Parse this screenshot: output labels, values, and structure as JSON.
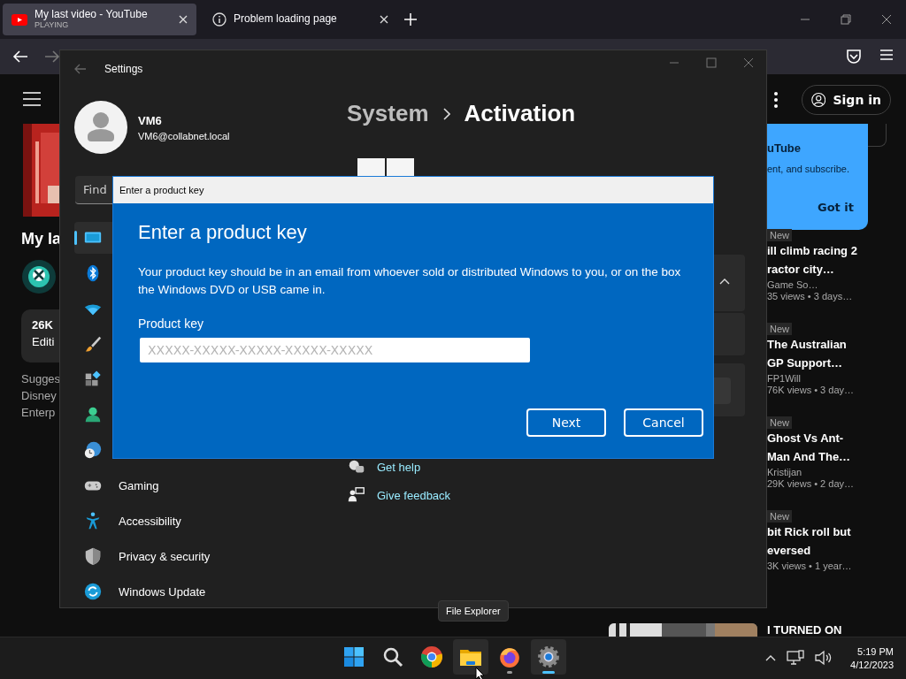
{
  "browser": {
    "tabs": [
      {
        "title": "My last video - YouTube",
        "status": "PLAYING",
        "selected": true
      },
      {
        "title": "Problem loading page",
        "selected": false
      }
    ]
  },
  "youtube": {
    "left": {
      "title": "My la",
      "views": "26K",
      "chip": "Editi",
      "lines": [
        "Sugges",
        "Disney",
        "Enterp"
      ]
    },
    "sign_in": "Sign in",
    "popup": {
      "title": "uTube",
      "text": "ent, and subscribe.",
      "button": "Got it"
    },
    "videos": [
      {
        "badge": "New",
        "title_lines": [
          "ill climb racing 2",
          "ractor city…"
        ],
        "channel": "Game So…",
        "meta": "35 views  • 3 days…"
      },
      {
        "badge": "New",
        "title_lines": [
          "The Australian",
          "GP Support…"
        ],
        "channel": "FP1Will",
        "meta": "76K views  • 3 day…"
      },
      {
        "badge": "New",
        "title_lines": [
          "Ghost Vs Ant-",
          "Man And The…"
        ],
        "channel": "Kristijan",
        "meta": "29K views  • 2 day…"
      },
      {
        "badge": "New",
        "title_lines": [
          "bit Rick roll but",
          "eversed"
        ],
        "meta": "3K views  • 1 year…"
      }
    ],
    "last_video": "I TURNED ON"
  },
  "settings": {
    "title": "Settings",
    "user": {
      "name": "VM6",
      "email": "VM6@collabnet.local"
    },
    "search_placeholder": "Find",
    "sidebar": [
      {
        "kind": "display",
        "selected": true
      },
      {
        "kind": "bluetooth",
        "selected": false
      },
      {
        "kind": "wifi",
        "selected": false
      },
      {
        "kind": "brush",
        "selected": false
      },
      {
        "kind": "apps",
        "selected": false
      },
      {
        "kind": "account",
        "selected": false
      },
      {
        "kind": "time",
        "selected": false
      },
      {
        "kind": "gaming",
        "label": "Gaming",
        "selected": false
      },
      {
        "kind": "accessibility",
        "label": "Accessibility",
        "selected": false
      },
      {
        "kind": "privacy",
        "label": "Privacy & security",
        "selected": false
      },
      {
        "kind": "update",
        "label": "Windows Update",
        "selected": false
      }
    ],
    "breadcrumb": [
      "System",
      "Activation"
    ],
    "links": [
      {
        "kind": "help",
        "label": "Get help"
      },
      {
        "kind": "feedback",
        "label": "Give feedback"
      }
    ]
  },
  "dialog": {
    "title": "Enter a product key",
    "heading": "Enter a product key",
    "text": "Your product key should be in an email from whoever sold or distributed Windows to you, or on the box the Windows DVD or USB came in.",
    "field_label": "Product key",
    "placeholder": "XXXXX-XXXXX-XXXXX-XXXXX-XXXXX",
    "buttons": [
      "Next",
      "Cancel"
    ]
  },
  "taskbar": {
    "tooltip": "File Explorer",
    "apps": [
      {
        "kind": "start",
        "running": false,
        "active": false,
        "hovered": false
      },
      {
        "kind": "search",
        "running": false,
        "active": false,
        "hovered": false
      },
      {
        "kind": "chrome",
        "running": false,
        "active": false,
        "hovered": false
      },
      {
        "kind": "explorer",
        "running": false,
        "active": false,
        "hovered": true
      },
      {
        "kind": "firefox",
        "running": true,
        "active": false,
        "hovered": false
      },
      {
        "kind": "settings",
        "running": true,
        "active": true,
        "hovered": false
      }
    ],
    "time": "5:19 PM",
    "date": "4/12/2023"
  }
}
